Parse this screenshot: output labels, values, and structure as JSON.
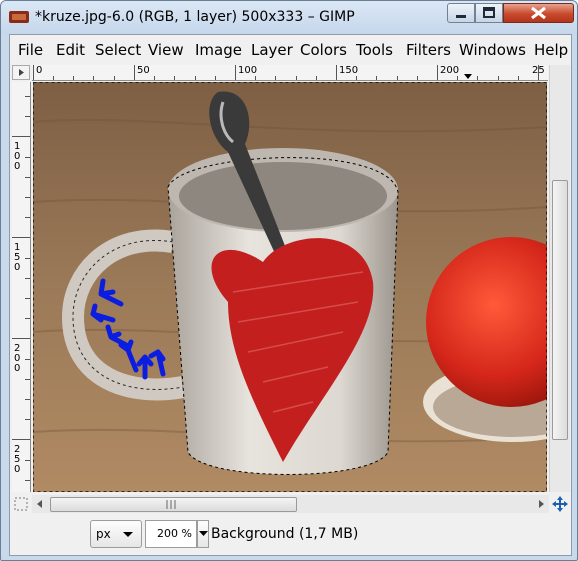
{
  "window": {
    "title": "*kruze.jpg-6.0 (RGB, 1 layer) 500x333 – GIMP"
  },
  "menu": [
    {
      "label": "File"
    },
    {
      "label": "Edit"
    },
    {
      "label": "Select"
    },
    {
      "label": "View"
    },
    {
      "label": "Image"
    },
    {
      "label": "Layer"
    },
    {
      "label": "Colors"
    },
    {
      "label": "Tools"
    },
    {
      "label": "Filters"
    },
    {
      "label": "Windows"
    },
    {
      "label": "Help"
    }
  ],
  "ruler_top": [
    "0",
    "50",
    "100",
    "150",
    "200",
    "25"
  ],
  "ruler_left": [
    "100",
    "150",
    "200",
    "250"
  ],
  "status": {
    "unit": "px",
    "zoom": "200 %",
    "layer_info": "Background (1,7 MB)"
  },
  "colors": {
    "titlebar": "#c6d7ec",
    "close_button": "#c94a2d",
    "mug_heart": "#c31f1f",
    "arrows": "#0b1de0",
    "table_wood": "#9b7a58"
  },
  "icons": [
    "gimp-app-icon",
    "minimize-icon",
    "maximize-icon",
    "close-icon",
    "quick-mask-icon",
    "navigate-icon",
    "ruler-menu-icon",
    "chevron-down-icon"
  ]
}
